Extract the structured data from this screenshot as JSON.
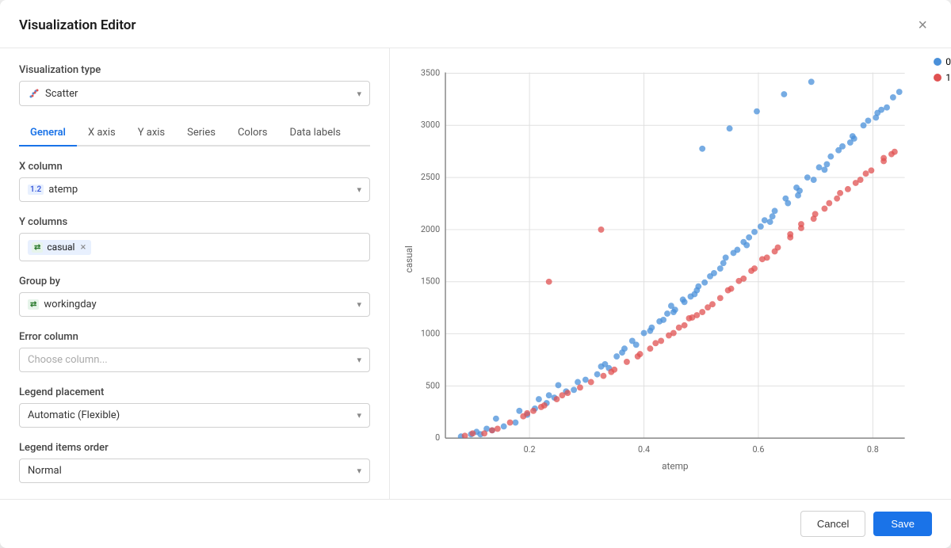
{
  "dialog": {
    "title": "Visualization Editor",
    "close_label": "×"
  },
  "visualization_type": {
    "label": "Visualization type",
    "value": "Scatter",
    "icon": "scatter-icon"
  },
  "tabs": [
    {
      "label": "General",
      "active": true
    },
    {
      "label": "X axis",
      "active": false
    },
    {
      "label": "Y axis",
      "active": false
    },
    {
      "label": "Series",
      "active": false
    },
    {
      "label": "Colors",
      "active": false
    },
    {
      "label": "Data labels",
      "active": false
    }
  ],
  "x_column": {
    "label": "X column",
    "value": "atemp",
    "icon_type": "numeric"
  },
  "y_columns": {
    "label": "Y columns",
    "tags": [
      {
        "label": "casual",
        "icon_type": "categorical"
      }
    ]
  },
  "group_by": {
    "label": "Group by",
    "value": "workingday",
    "icon_type": "categorical"
  },
  "error_column": {
    "label": "Error column",
    "placeholder": "Choose column..."
  },
  "legend_placement": {
    "label": "Legend placement",
    "value": "Automatic (Flexible)"
  },
  "legend_items_order": {
    "label": "Legend items order",
    "value": "Normal"
  },
  "footer": {
    "cancel_label": "Cancel",
    "save_label": "Save"
  },
  "chart": {
    "x_axis_label": "atemp",
    "y_axis_label": "casual",
    "x_ticks": [
      "0.2",
      "0.4",
      "0.6",
      "0.8"
    ],
    "y_ticks": [
      "0",
      "500",
      "1000",
      "1500",
      "2000",
      "2500",
      "3000",
      "3500"
    ],
    "legend": [
      {
        "label": "0",
        "color": "#4a90d9"
      },
      {
        "label": "1",
        "color": "#e05252"
      }
    ]
  },
  "colors": {
    "blue": "#4a90d9",
    "red": "#e05252",
    "accent": "#1a73e8"
  }
}
